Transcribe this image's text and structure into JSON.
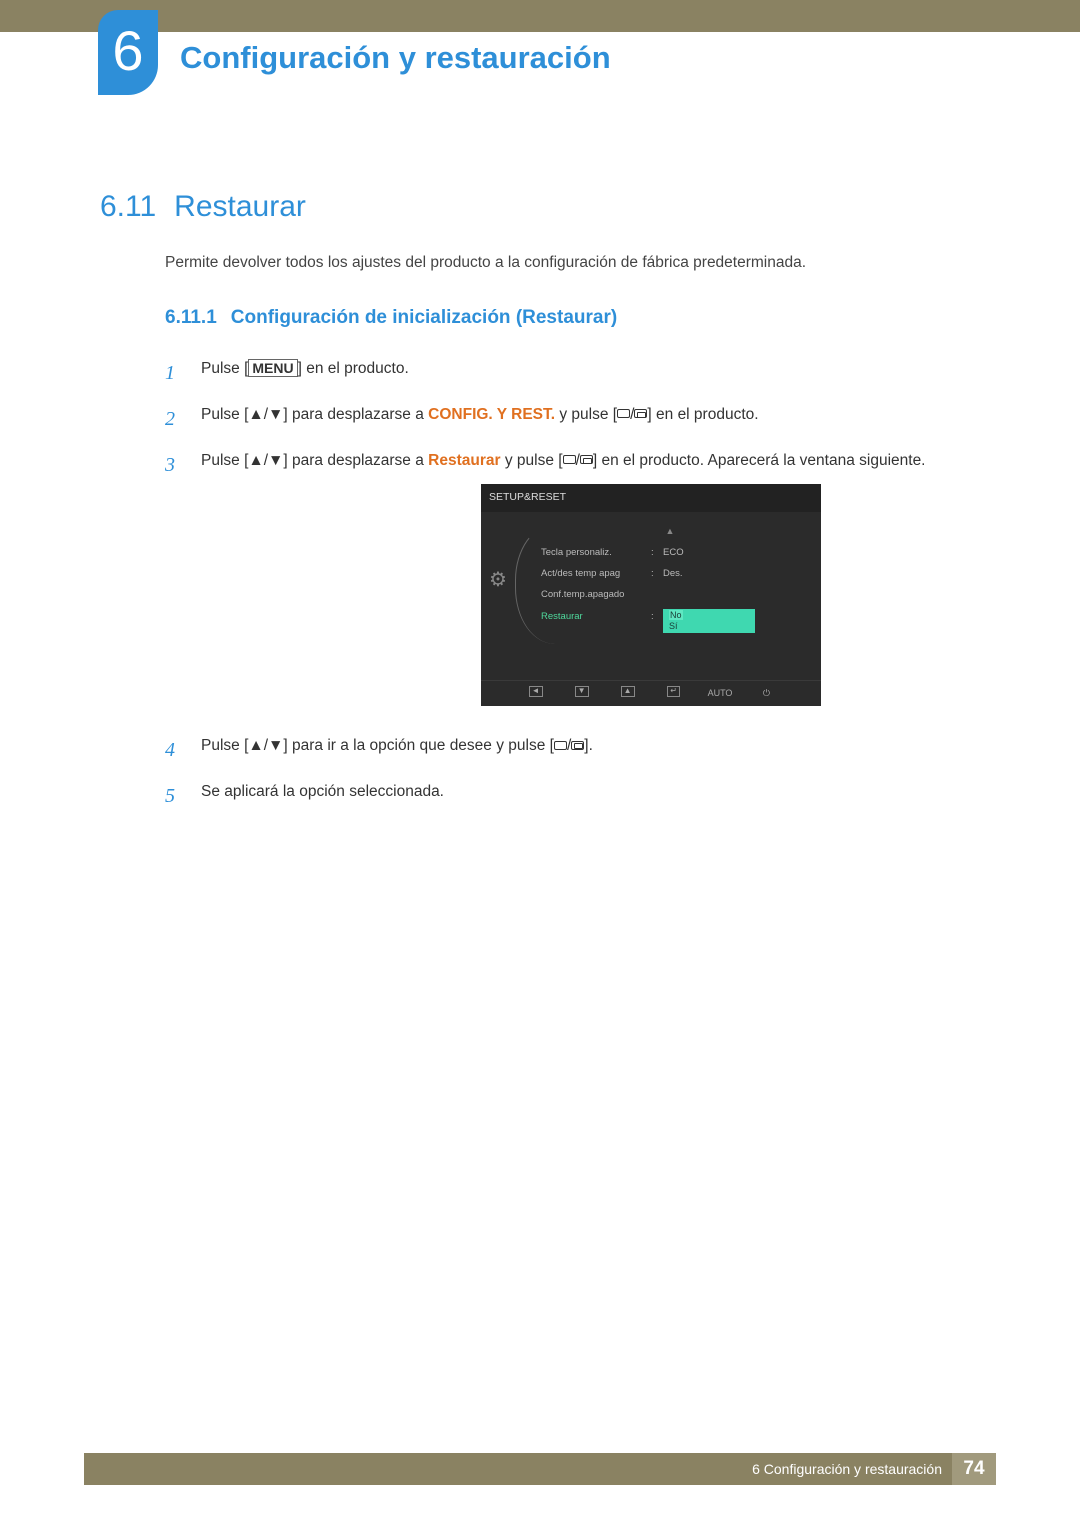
{
  "chapter": {
    "number": "6",
    "title": "Configuración y restauración"
  },
  "section": {
    "number": "6.11",
    "title": "Restaurar"
  },
  "intro": "Permite devolver todos los ajustes del producto a la configuración de fábrica predeterminada.",
  "subsection": {
    "number": "6.11.1",
    "title": "Configuración de inicialización (Restaurar)"
  },
  "steps": {
    "s1": {
      "num": "1",
      "a": "Pulse [",
      "menu": "MENU",
      "b": "] en el producto."
    },
    "s2": {
      "num": "2",
      "a": "Pulse [",
      "arrows": "▲/▼",
      "b": "] para desplazarse a ",
      "hi": "CONFIG. Y REST.",
      "c": " y pulse [",
      "d": "] en el producto."
    },
    "s3": {
      "num": "3",
      "a": "Pulse [",
      "arrows": "▲/▼",
      "b": "] para desplazarse a ",
      "hi": "Restaurar",
      "c": " y pulse [",
      "d": "] en el producto. Aparecerá la ventana siguiente."
    },
    "s4": {
      "num": "4",
      "a": "Pulse [",
      "arrows": "▲/▼",
      "b": "] para ir a la opción que desee y pulse [",
      "c": "]."
    },
    "s5": {
      "num": "5",
      "a": "Se aplicará la opción seleccionada."
    }
  },
  "osd": {
    "title": "SETUP&RESET",
    "rows": [
      {
        "label": "Tecla personaliz.",
        "value": "ECO"
      },
      {
        "label": "Act/des temp apag",
        "value": "Des."
      },
      {
        "label": "Conf.temp.apagado",
        "value": ""
      },
      {
        "label": "Restaurar",
        "value": "",
        "green": true
      }
    ],
    "popup": {
      "no": "No",
      "si": "Sí"
    },
    "buttons": {
      "auto": "AUTO"
    }
  },
  "footer": {
    "text": "6 Configuración y restauración",
    "page": "74"
  }
}
